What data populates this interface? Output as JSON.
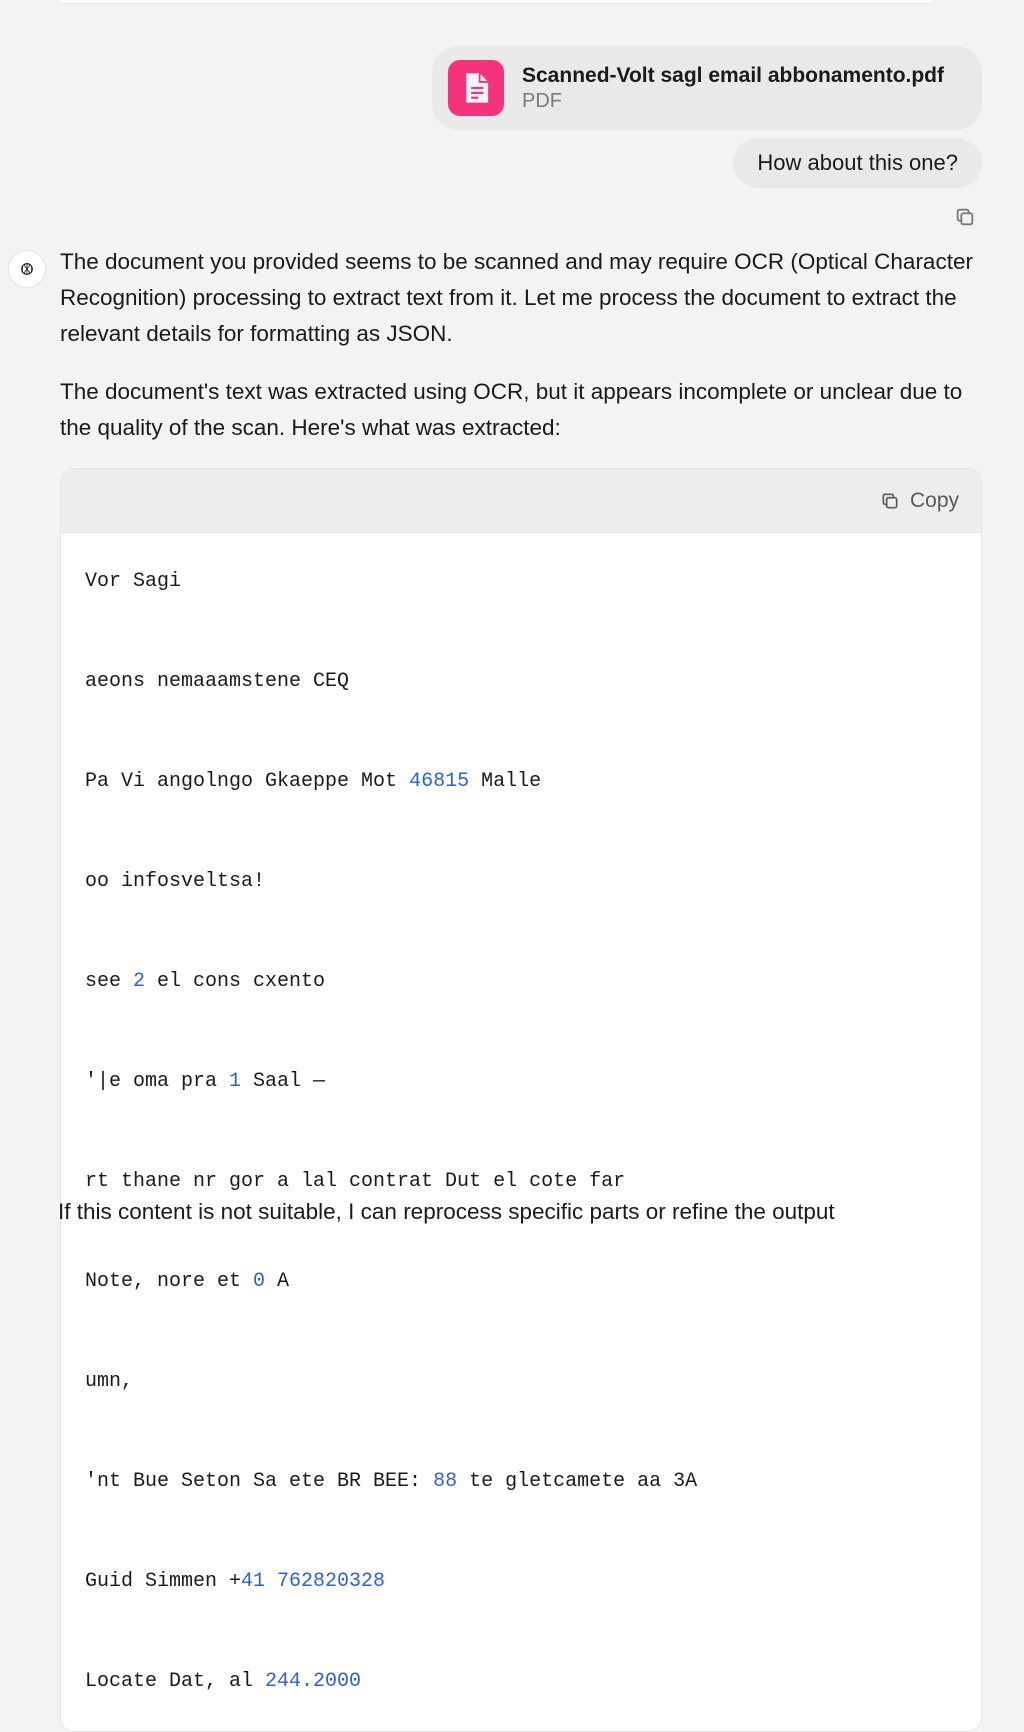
{
  "attachment": {
    "filename": "Scanned-Volt sagl email abbonamento.pdf",
    "filetype": "PDF"
  },
  "user_message": "How about this one?",
  "assistant": {
    "p1": "The document you provided seems to be scanned and may require OCR (Optical Character Recognition) processing to extract text from it. Let me process the document to extract the relevant details for formatting as JSON.",
    "p2": "The document's text was extracted using OCR, but it appears incomplete or unclear due to the quality of the scan. Here's what was extracted:",
    "p3_cutoff": "If this content is not suitable, I can reprocess specific parts or refine the output"
  },
  "code": {
    "copy_label": "Copy",
    "lines": [
      [
        {
          "t": "Vor Sagi"
        }
      ],
      [
        {
          "t": "aeons nemaaamstene CEQ"
        }
      ],
      [
        {
          "t": "Pa Vi angolngo Gkaeppe Mot "
        },
        {
          "t": "46815",
          "n": true
        },
        {
          "t": " Malle"
        }
      ],
      [
        {
          "t": "oo infosveltsa!"
        }
      ],
      [
        {
          "t": "see "
        },
        {
          "t": "2",
          "n": true
        },
        {
          "t": " el cons cxento"
        }
      ],
      [
        {
          "t": "'|e oma pra "
        },
        {
          "t": "1",
          "n": true
        },
        {
          "t": " Saal —"
        }
      ],
      [
        {
          "t": "rt thane nr gor a lal contrat Dut el cote far"
        }
      ],
      [
        {
          "t": "Note, nore et "
        },
        {
          "t": "0",
          "n": true
        },
        {
          "t": " A"
        }
      ],
      [
        {
          "t": "umn,"
        }
      ],
      [
        {
          "t": "'nt Bue Seton Sa ete BR BEE: "
        },
        {
          "t": "88",
          "n": true
        },
        {
          "t": " te gletcamete aa 3A"
        }
      ],
      [
        {
          "t": "Guid Simmen +"
        },
        {
          "t": "41 762820328",
          "n": true
        }
      ],
      [
        {
          "t": "Locate Dat, al "
        },
        {
          "t": "244.2000",
          "n": true
        }
      ]
    ]
  }
}
